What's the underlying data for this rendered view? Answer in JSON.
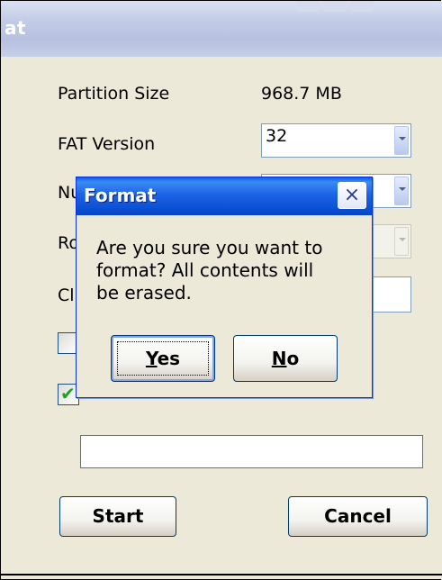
{
  "window": {
    "title_fragment": "at"
  },
  "form": {
    "partition_size_label": "Partition Size",
    "partition_size_value": "968.7 MB",
    "fat_version_label": "FAT Version",
    "fat_version_value": "32",
    "row3_label_partial": "Nu",
    "row4_label_partial": "Ro",
    "row5_label_partial": "Clu",
    "checkbox1_checked": false,
    "checkbox2_checked": true,
    "start_label": "Start",
    "cancel_label": "Cancel"
  },
  "dialog": {
    "title": "Format",
    "close_symbol": "×",
    "message_line1": "Are you sure you want to",
    "message_line2": "format?  All contents will",
    "message_line3": "be erased.",
    "yes_accesskey": "Y",
    "yes_rest": "es",
    "no_accesskey": "N",
    "no_rest": "o"
  },
  "icons": [
    "close-icon",
    "dropdown-arrow-icon",
    "checkmark-icon"
  ],
  "colors": {
    "titlebar_blue": "#0a4fd2",
    "dialog_face": "#ece9d8",
    "check_green": "#21a121"
  }
}
